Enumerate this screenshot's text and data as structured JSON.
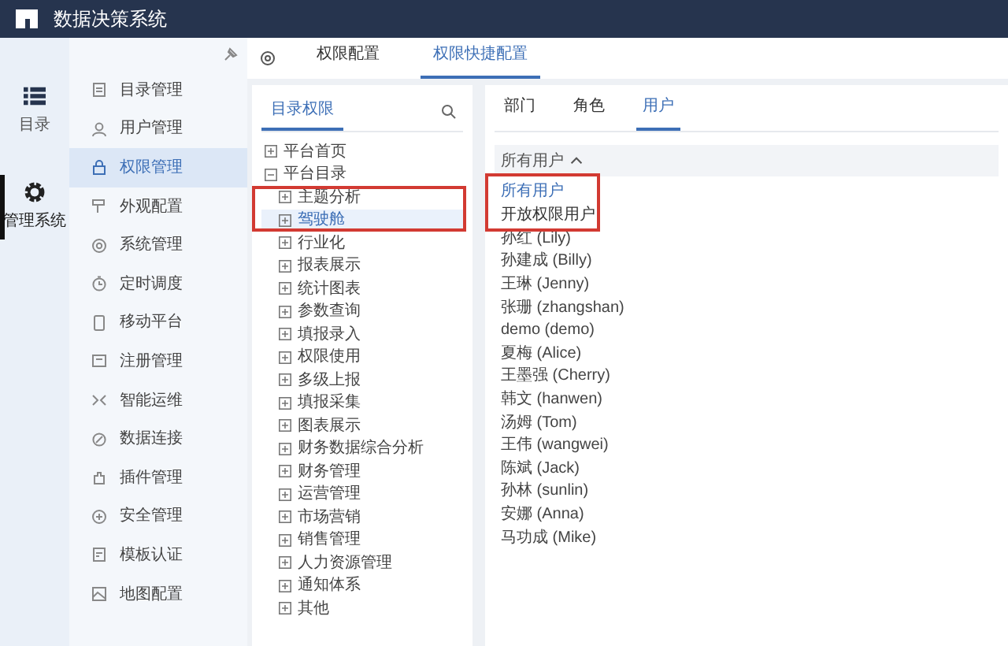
{
  "app": {
    "title": "数据决策系统"
  },
  "rail": [
    {
      "label": "目录",
      "selected": false
    },
    {
      "label": "管理系统",
      "selected": true
    }
  ],
  "menu": [
    {
      "label": "目录管理",
      "selected": false
    },
    {
      "label": "用户管理",
      "selected": false
    },
    {
      "label": "权限管理",
      "selected": true
    },
    {
      "label": "外观配置",
      "selected": false
    },
    {
      "label": "系统管理",
      "selected": false
    },
    {
      "label": "定时调度",
      "selected": false
    },
    {
      "label": "移动平台",
      "selected": false
    },
    {
      "label": "注册管理",
      "selected": false
    },
    {
      "label": "智能运维",
      "selected": false
    },
    {
      "label": "数据连接",
      "selected": false
    },
    {
      "label": "插件管理",
      "selected": false
    },
    {
      "label": "安全管理",
      "selected": false
    },
    {
      "label": "模板认证",
      "selected": false
    },
    {
      "label": "地图配置",
      "selected": false
    }
  ],
  "tabs": [
    {
      "label": "权限配置",
      "selected": false
    },
    {
      "label": "权限快捷配置",
      "selected": true
    }
  ],
  "catalog_panel": {
    "tab": "目录权限",
    "tree": [
      {
        "label": "平台首页",
        "expanded": false,
        "selected": false
      },
      {
        "label": "平台目录",
        "expanded": true,
        "selected": false,
        "children": [
          {
            "label": "主题分析",
            "expanded": false,
            "selected": false
          },
          {
            "label": "驾驶舱",
            "expanded": false,
            "selected": true
          },
          {
            "label": "行业化",
            "expanded": false,
            "selected": false
          },
          {
            "label": "报表展示",
            "expanded": false,
            "selected": false
          },
          {
            "label": "统计图表",
            "expanded": false,
            "selected": false
          },
          {
            "label": "参数查询",
            "expanded": false,
            "selected": false
          },
          {
            "label": "填报录入",
            "expanded": false,
            "selected": false
          },
          {
            "label": "权限使用",
            "expanded": false,
            "selected": false
          },
          {
            "label": "多级上报",
            "expanded": false,
            "selected": false
          },
          {
            "label": "填报采集",
            "expanded": false,
            "selected": false
          },
          {
            "label": "图表展示",
            "expanded": false,
            "selected": false
          },
          {
            "label": "财务数据综合分析",
            "expanded": false,
            "selected": false
          },
          {
            "label": "财务管理",
            "expanded": false,
            "selected": false
          },
          {
            "label": "运营管理",
            "expanded": false,
            "selected": false
          },
          {
            "label": "市场营销",
            "expanded": false,
            "selected": false
          },
          {
            "label": "销售管理",
            "expanded": false,
            "selected": false
          },
          {
            "label": "人力资源管理",
            "expanded": false,
            "selected": false
          },
          {
            "label": "通知体系",
            "expanded": false,
            "selected": false
          },
          {
            "label": "其他",
            "expanded": false,
            "selected": false
          }
        ]
      }
    ]
  },
  "user_panel": {
    "tabs": [
      {
        "label": "部门",
        "selected": false
      },
      {
        "label": "角色",
        "selected": false
      },
      {
        "label": "用户",
        "selected": true
      }
    ],
    "filter": {
      "value": "所有用户",
      "expanded": true
    },
    "options": [
      {
        "label": "所有用户",
        "selected": true
      },
      {
        "label": "开放权限用户",
        "selected": false
      }
    ],
    "users": [
      "孙红 (Lily)",
      "孙建成 (Billy)",
      "王琳 (Jenny)",
      "张珊 (zhangshan)",
      "demo (demo)",
      "夏梅 (Alice)",
      "王墨强 (Cherry)",
      "韩文 (hanwen)",
      "汤姆 (Tom)",
      "王伟 (wangwei)",
      "陈斌 (Jack)",
      "孙林 (sunlin)",
      "安娜 (Anna)",
      "马功成 (Mike)"
    ]
  }
}
